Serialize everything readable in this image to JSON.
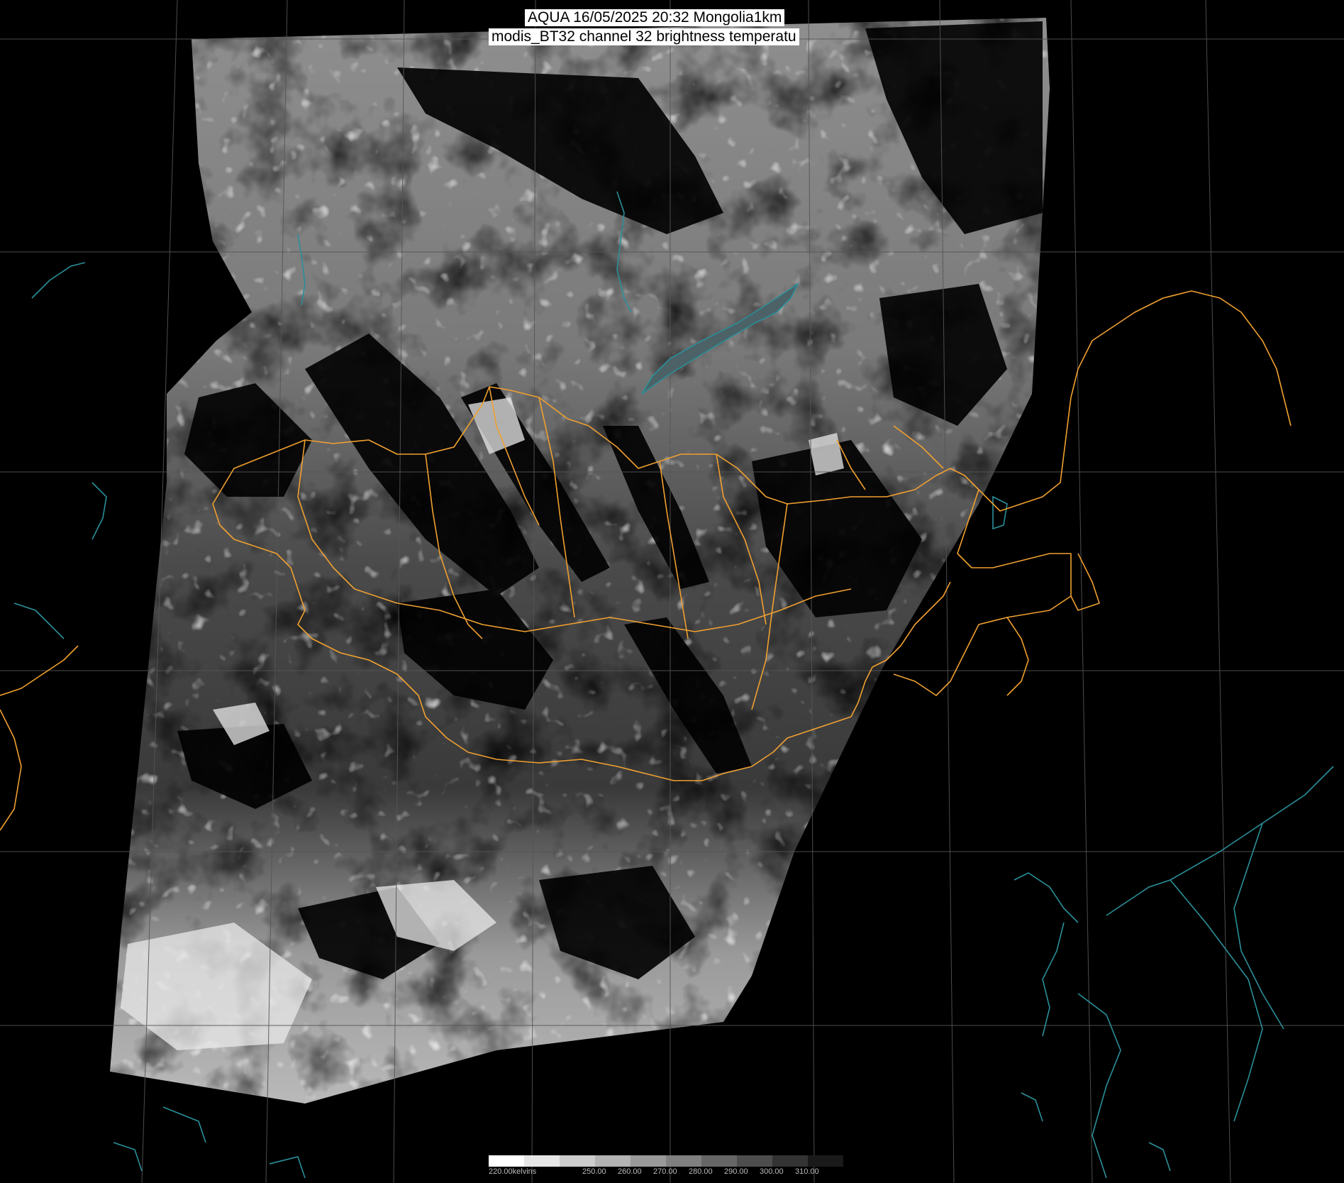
{
  "header": {
    "title_line1": "AQUA 16/05/2025 20:32 Mongolia1km",
    "title_line2": "modis_BT32 channel 32 brightness temperatu"
  },
  "legend": {
    "unit_label": "220.00kelvins",
    "ticks": [
      "250.00",
      "260.00",
      "270.00",
      "280.00",
      "290.00",
      "300.00",
      "310.00"
    ],
    "colors": [
      "#ffffff",
      "#e6e6e6",
      "#cccccc",
      "#b3b3b3",
      "#999999",
      "#808080",
      "#666666",
      "#4d4d4d",
      "#333333",
      "#1a1a1a"
    ]
  },
  "map": {
    "border_color": "#f0a030",
    "coast_color": "#2a8f9a",
    "grid_color": "#555555",
    "background": "#000000"
  }
}
